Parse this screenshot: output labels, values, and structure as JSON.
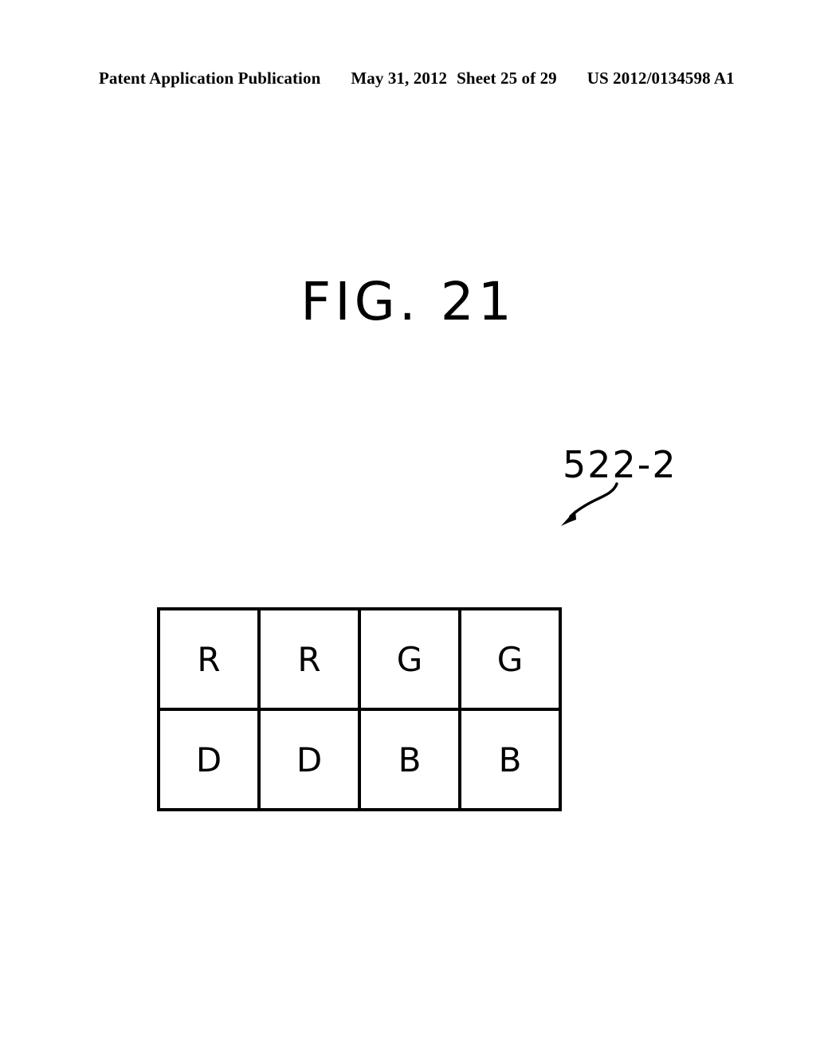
{
  "header": {
    "publication": "Patent Application Publication",
    "date": "May 31, 2012",
    "sheet": "Sheet 25 of 29",
    "document_number": "US 2012/0134598 A1"
  },
  "figure": {
    "title": "FIG. 21",
    "reference_numeral": "522-2",
    "leader_icon": "curved-arrow-icon"
  },
  "chart_data": {
    "type": "table",
    "title": "FIG. 21",
    "reference_numeral": "522-2",
    "rows": 2,
    "columns": 4,
    "grid": [
      [
        "R",
        "R",
        "G",
        "G"
      ],
      [
        "D",
        "D",
        "B",
        "B"
      ]
    ]
  }
}
